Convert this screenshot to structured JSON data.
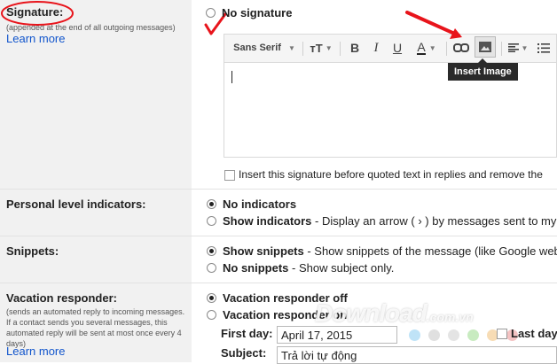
{
  "signature": {
    "heading": "Signature:",
    "sub": "(appended at the end of all outgoing messages)",
    "learn_more": "Learn more",
    "no_signature": "No signature",
    "toolbar": {
      "font": "Sans Serif",
      "font_size_icon": "text-size-icon",
      "bold": "B",
      "italic": "I",
      "underline": "U",
      "text_color": "A",
      "link_icon": "link-icon",
      "image_icon": "insert-image-icon",
      "align_icon": "align-icon",
      "list_icon": "numbered-list-icon"
    },
    "tooltip": "Insert Image",
    "insert_before_quoted": "Insert this signature before quoted text in replies and remove the"
  },
  "personal": {
    "heading": "Personal level indicators:",
    "no_indicators": "No indicators",
    "show_indicators_bold": "Show indicators",
    "show_indicators_rest": " - Display an arrow ( › ) by messages sent to my a"
  },
  "snippets": {
    "heading": "Snippets:",
    "show_bold": "Show snippets",
    "show_rest": " - Show snippets of the message (like Google web",
    "no_bold": "No snippets",
    "no_rest": " - Show subject only."
  },
  "vacation": {
    "heading": "Vacation responder:",
    "sub": "(sends an automated reply to incoming messages. If a contact sends you several messages, this automated reply will be sent at most once every 4 days)",
    "learn_more": "Learn more",
    "off": "Vacation responder off",
    "on": "Vacation responder on",
    "first_day_label": "First day:",
    "first_day_value": "April 17, 2015",
    "last_day_label": "Last day",
    "subject_label": "Subject:",
    "subject_value": "Trả lời tự động"
  },
  "watermark": {
    "text": "Download",
    "suffix": ".com.vn"
  },
  "colors": {
    "annotation_red": "#e8141b",
    "link": "#1155cc",
    "left_bg": "#f1f1f1",
    "dot_colors": [
      "#bfe3f7",
      "#e0e0e0",
      "#e4e4e4",
      "#c8ebc0",
      "#f7dcb5",
      "#f4c3c3"
    ]
  }
}
